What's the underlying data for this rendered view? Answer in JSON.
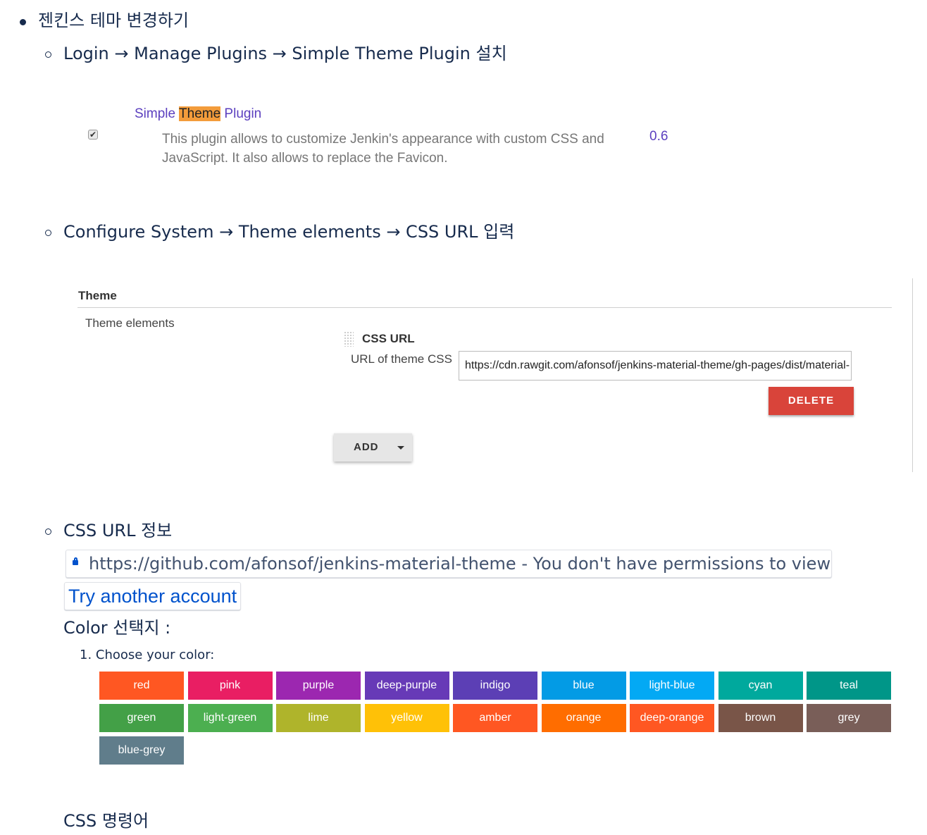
{
  "bullets": {
    "main": "젠킨스 테마 변경하기",
    "step1": "Login → Manage Plugins → Simple Theme Plugin 설치",
    "step2": "Configure System → Theme elements → CSS URL 입력",
    "step3": "CSS URL 정보"
  },
  "plugin": {
    "name_before": "Simple ",
    "name_highlight": "Theme",
    "name_after": " Plugin",
    "description": "This plugin allows to customize Jenkin's appearance with custom CSS and JavaScript. It also allows to replace the Favicon.",
    "version": "0.6",
    "checked": "✔"
  },
  "config": {
    "section_title": "Theme",
    "theme_elements_label": "Theme elements",
    "css_url_title": "CSS URL",
    "url_label": "URL of theme CSS",
    "url_value": "https://cdn.rawgit.com/afonsof/jenkins-material-theme/gh-pages/dist/material-",
    "delete_label": "DELETE",
    "add_label": "ADD"
  },
  "link_card": {
    "text": "https://github.com/afonsof/jenkins-material-theme - You don't have permissions to view",
    "try_another": "Try another account",
    "icon": "lock-icon"
  },
  "color_heading": "Color 선택지 :",
  "choose_color": "1. Choose your color:",
  "css_commands": "CSS 명령어",
  "colors": [
    {
      "name": "red",
      "hex": "#ff5722"
    },
    {
      "name": "pink",
      "hex": "#e91e63"
    },
    {
      "name": "purple",
      "hex": "#9c27b0"
    },
    {
      "name": "deep-purple",
      "hex": "#673ab7"
    },
    {
      "name": "indigo",
      "hex": "#5c3fb5"
    },
    {
      "name": "blue",
      "hex": "#039be5"
    },
    {
      "name": "light-blue",
      "hex": "#03a9f4"
    },
    {
      "name": "cyan",
      "hex": "#00a99d"
    },
    {
      "name": "teal",
      "hex": "#009688"
    },
    {
      "name": "green",
      "hex": "#43a047"
    },
    {
      "name": "light-green",
      "hex": "#4caf50"
    },
    {
      "name": "lime",
      "hex": "#afb42b"
    },
    {
      "name": "yellow",
      "hex": "#ffc107"
    },
    {
      "name": "amber",
      "hex": "#ff5722"
    },
    {
      "name": "orange",
      "hex": "#ff6d00"
    },
    {
      "name": "deep-orange",
      "hex": "#ff5722"
    },
    {
      "name": "brown",
      "hex": "#795548"
    },
    {
      "name": "grey",
      "hex": "#795e58"
    },
    {
      "name": "blue-grey",
      "hex": "#607d8b"
    }
  ]
}
